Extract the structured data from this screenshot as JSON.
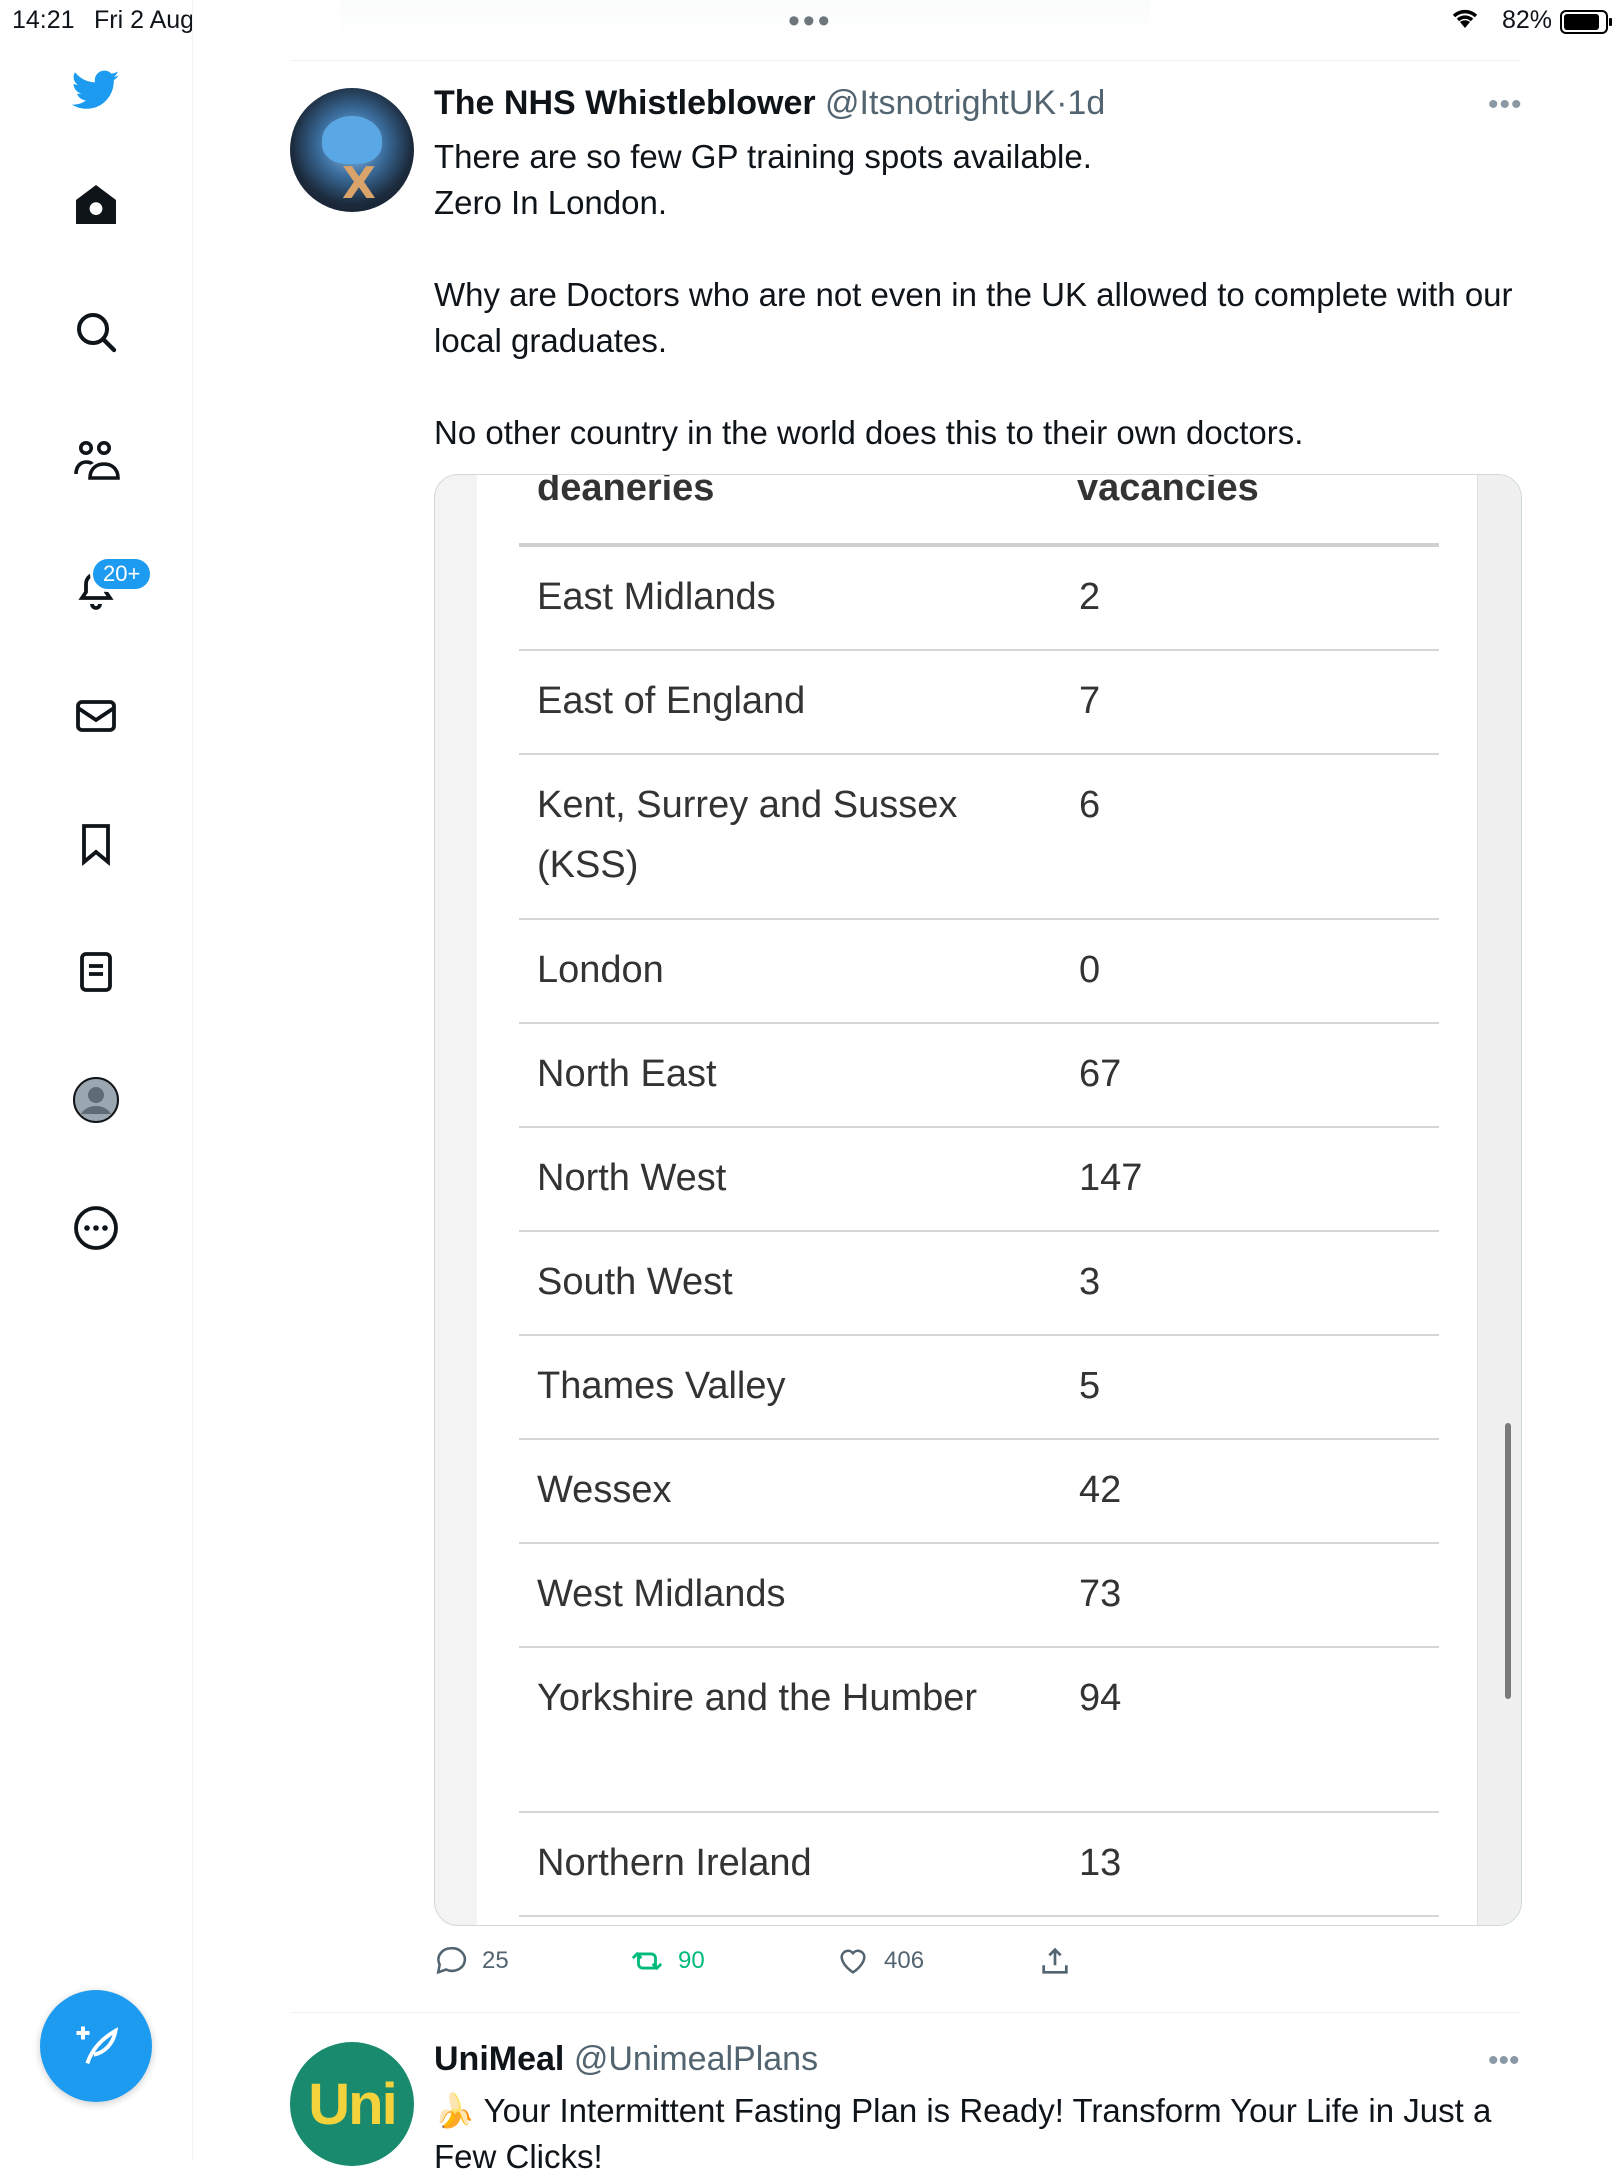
{
  "status_bar": {
    "time": "14:21",
    "date": "Fri 2 Aug",
    "battery": "82%"
  },
  "sidebar": {
    "notification_badge": "20+",
    "items": [
      "Home",
      "Search",
      "Communities",
      "Notifications",
      "Messages",
      "Bookmarks",
      "Lists",
      "Profile",
      "More"
    ]
  },
  "tweet": {
    "name": "The NHS Whistleblower",
    "handle": "@ItsnotrightUK",
    "separator": "·",
    "time": "1d",
    "text_lines": [
      "There are so few GP training spots available.",
      "Zero In London.",
      "Why are Doctors who are not even in the UK allowed to complete with our local graduates.",
      "No other country in the world does this to their own doctors."
    ],
    "image": {
      "headers": [
        "deaneries",
        "vacancies"
      ],
      "rows": [
        {
          "deanery": "East Midlands",
          "vacancies": "2"
        },
        {
          "deanery": "East of England",
          "vacancies": "7"
        },
        {
          "deanery": "Kent, Surrey and Sussex (KSS)",
          "vacancies": "6"
        },
        {
          "deanery": "London",
          "vacancies": "0"
        },
        {
          "deanery": "North East",
          "vacancies": "67"
        },
        {
          "deanery": "North West",
          "vacancies": "147"
        },
        {
          "deanery": "South West",
          "vacancies": "3"
        },
        {
          "deanery": "Thames Valley",
          "vacancies": "5"
        },
        {
          "deanery": "Wessex",
          "vacancies": "42"
        },
        {
          "deanery": "West Midlands",
          "vacancies": "73"
        },
        {
          "deanery": "Yorkshire and the Humber",
          "vacancies": "94"
        },
        {
          "deanery": "Northern Ireland",
          "vacancies": "13"
        }
      ]
    },
    "actions": {
      "replies": "25",
      "retweets": "90",
      "likes": "406"
    }
  },
  "tweet2": {
    "name": "UniMeal",
    "handle": "@UnimealPlans",
    "avatar_text": "Uni",
    "emoji": "🍌",
    "text": "Your Intermittent Fasting Plan is Ready! Transform Your Life in Just a Few Clicks!"
  },
  "colors": {
    "accent": "#1d9bf0",
    "retweet": "#00ba7c",
    "text": "#0f1419",
    "muted": "#536471"
  }
}
